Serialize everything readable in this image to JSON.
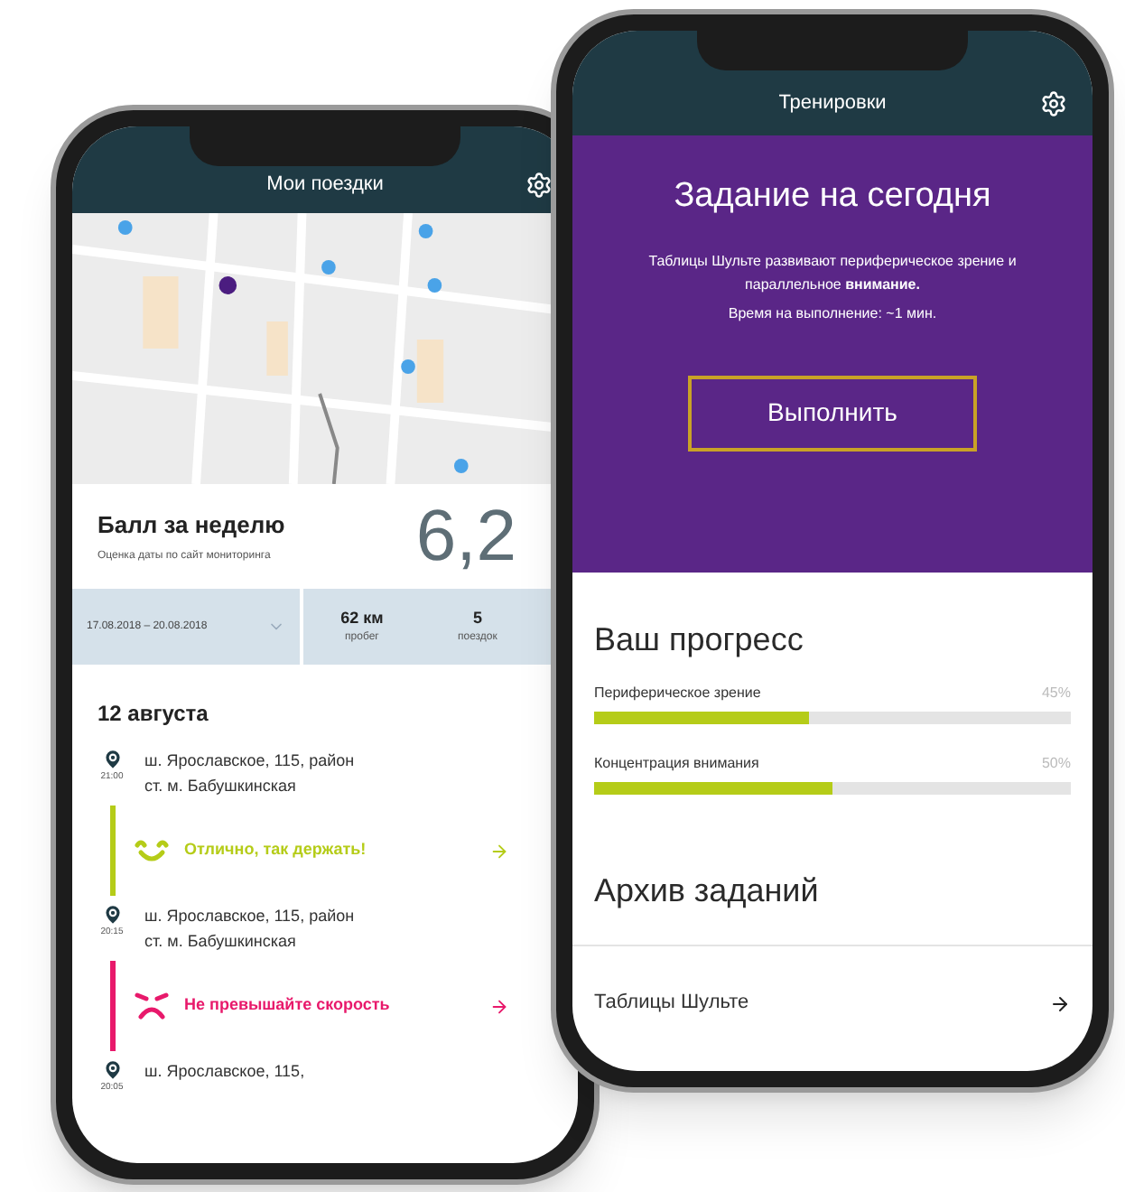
{
  "left_screen": {
    "title": "Мои поездки",
    "score": {
      "title": "Балл за неделю",
      "subtitle": "Оценка даты по сайт мониторинга",
      "value": "6,2"
    },
    "date_range": "17.08.2018 – 20.08.2018",
    "stats": [
      {
        "value": "62 км",
        "label": "пробег"
      },
      {
        "value": "5",
        "label": "поездок"
      }
    ],
    "date_heading": "12 августа",
    "timeline": [
      {
        "kind": "stop",
        "time": "21:00",
        "address": "ш. Ярославское, 115, район ст. м. Бабушкинская"
      },
      {
        "kind": "good",
        "text": "Отлично, так держать!",
        "color": "#b5cc18"
      },
      {
        "kind": "stop",
        "time": "20:15",
        "address": "ш. Ярославское, 115, район ст. м. Бабушкинская"
      },
      {
        "kind": "bad",
        "text": "Не превышайте скорость",
        "color": "#e8196b"
      },
      {
        "kind": "stop",
        "time": "20:05",
        "address": "ш. Ярославское, 115,"
      }
    ]
  },
  "right_screen": {
    "title": "Тренировки",
    "task": {
      "heading": "Задание на сегодня",
      "description": "Таблицы Шульте развивают периферическое зрение и параллельное **внимание.**",
      "time_note": "Время на выполнение: ~1 мин.",
      "button": "Выполнить"
    },
    "progress": {
      "heading": "Ваш прогресс",
      "items": [
        {
          "label": "Периферическое зрение",
          "reading": "45%",
          "level": 0.45
        },
        {
          "label": "Концентрация внимания",
          "reading": "50%",
          "level": 0.5
        }
      ]
    },
    "archive": {
      "heading": "Архив заданий",
      "items": [
        {
          "label": "Таблицы Шульте"
        }
      ]
    }
  }
}
